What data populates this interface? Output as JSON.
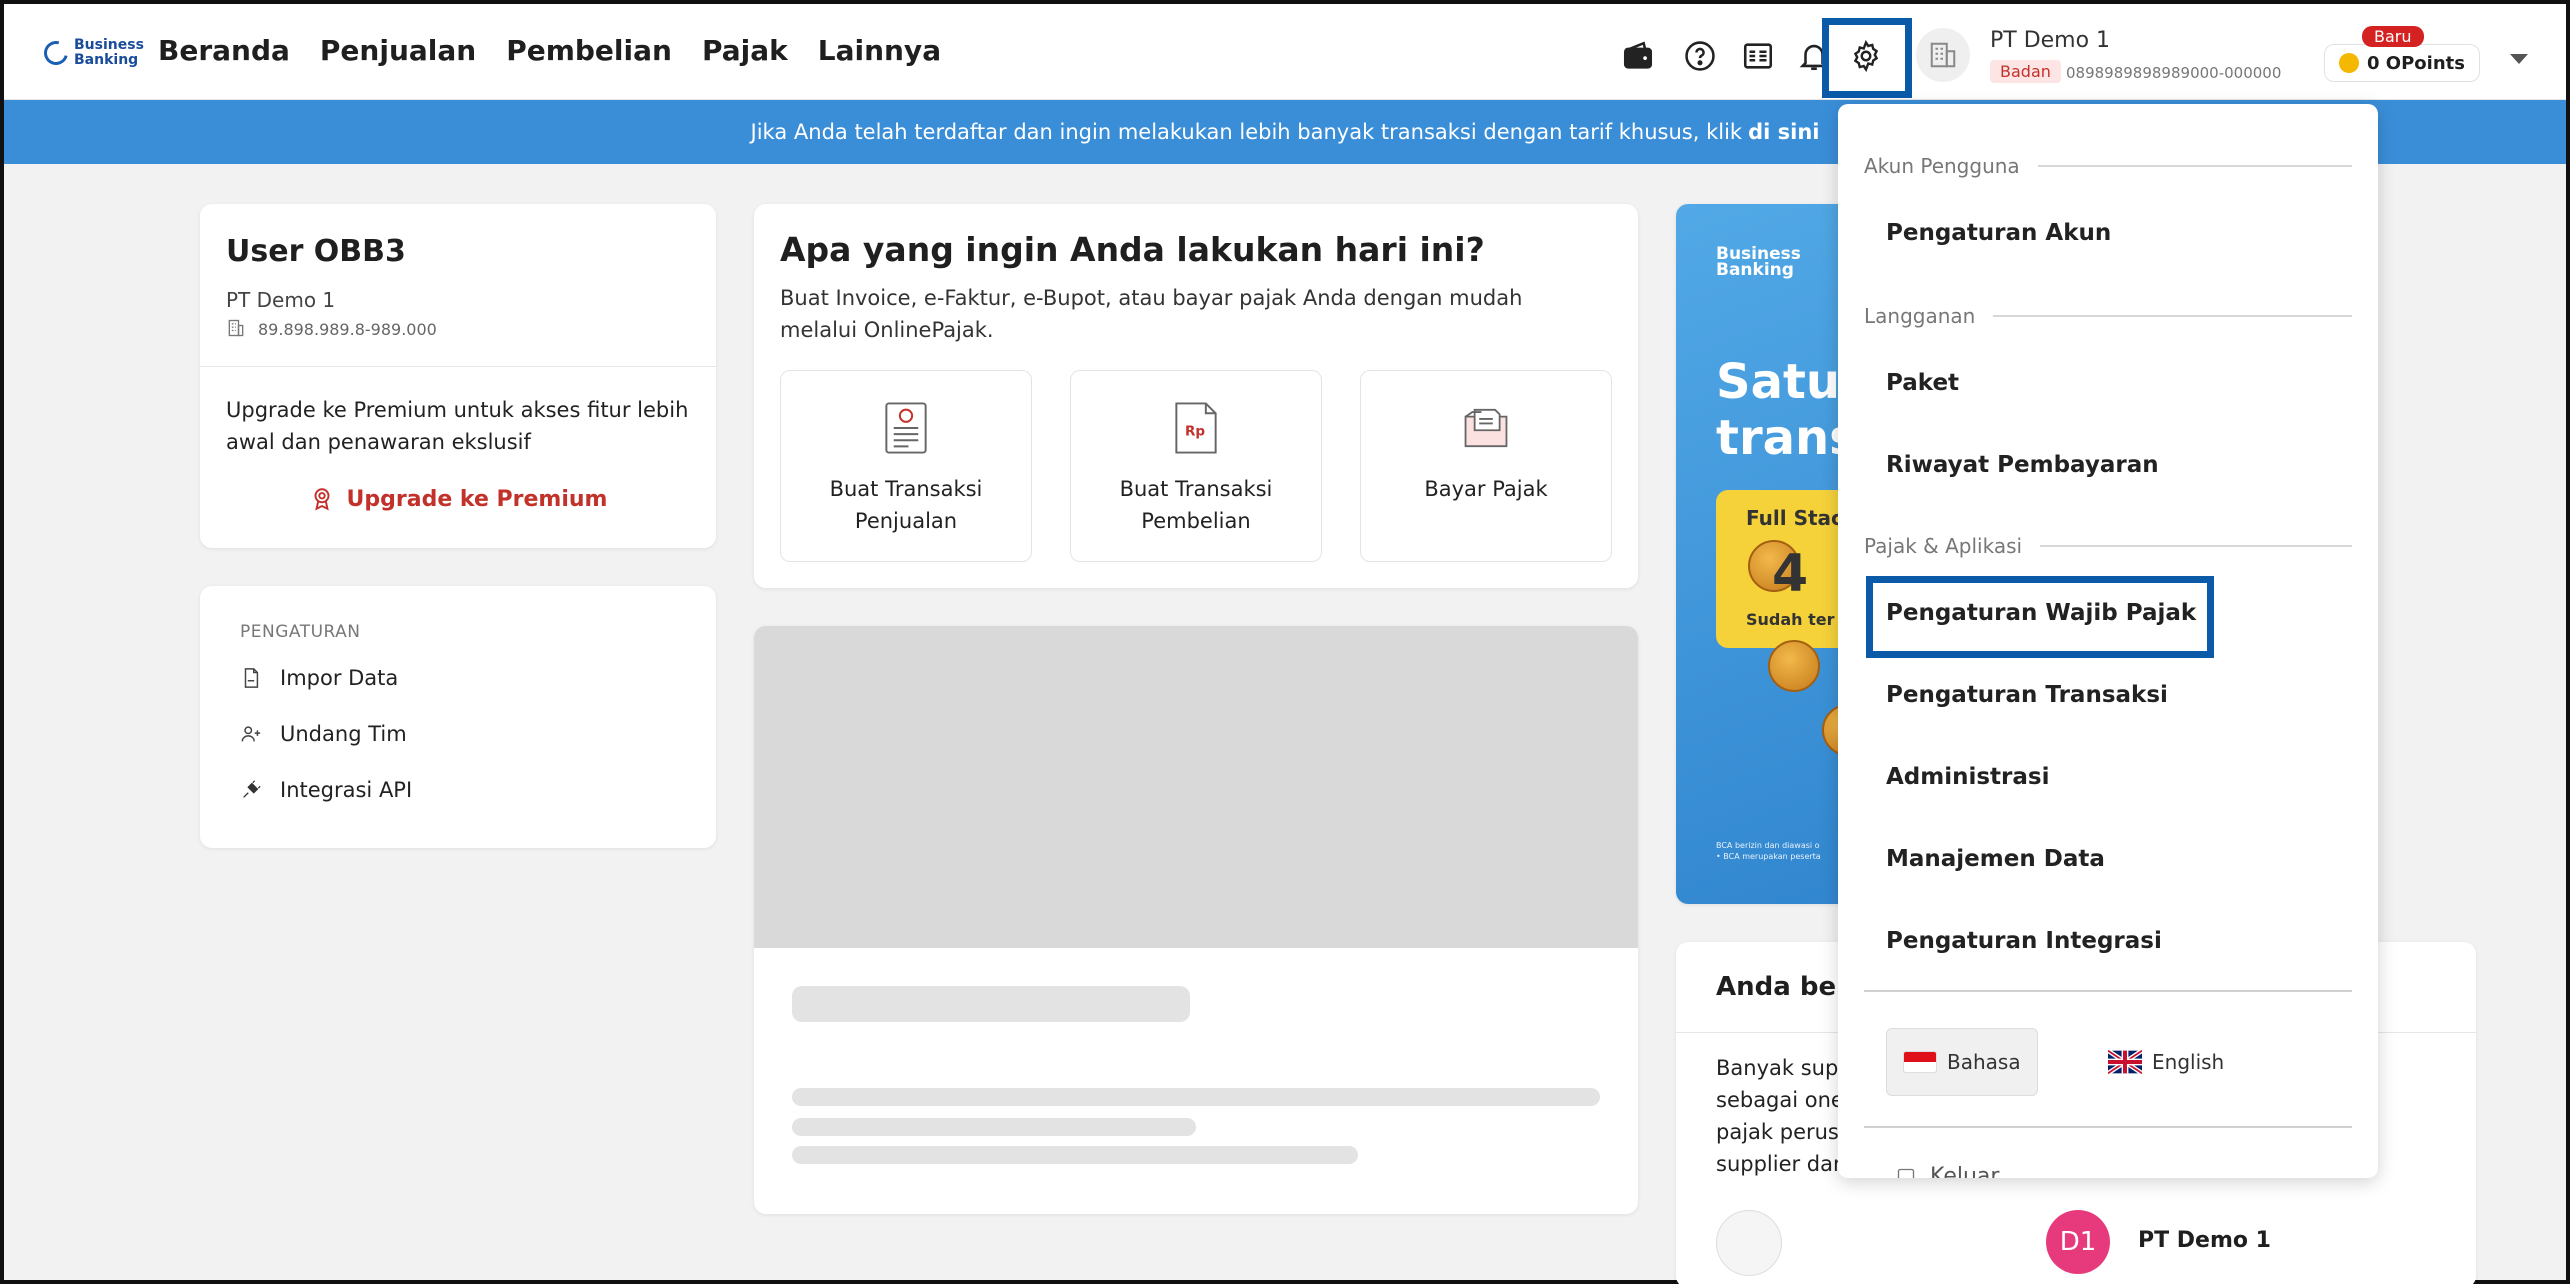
{
  "header": {
    "logo_text_1": "Business",
    "logo_text_2": "Banking",
    "nav": [
      "Beranda",
      "Penjualan",
      "Pembelian",
      "Pajak",
      "Lainnya"
    ],
    "company_name": "PT Demo 1",
    "entity_badge": "Badan",
    "phone": "0898989898989000-000000",
    "points_badge": "Baru",
    "points_label": "0 OPoints"
  },
  "banner": {
    "text": "Jika Anda telah terdaftar dan ingin melakukan lebih banyak transaksi dengan tarif khusus, klik",
    "link": "di sini"
  },
  "user_card": {
    "name": "User OBB3",
    "company": "PT Demo 1",
    "npwp": "89.898.989.8-989.000",
    "upgrade_desc": "Upgrade ke Premium untuk akses fitur lebih awal dan penawaran ekslusif",
    "upgrade_link": "Upgrade ke Premium"
  },
  "settings_card": {
    "heading": "PENGATURAN",
    "items": [
      "Impor Data",
      "Undang Tim",
      "Integrasi API"
    ]
  },
  "action_card": {
    "title": "Apa yang ingin Anda lakukan hari ini?",
    "subtitle": "Buat Invoice, e-Faktur, e-Bupot, atau bayar pajak Anda dengan mudah melalui OnlinePajak.",
    "tiles": [
      {
        "label_1": "Buat Transaksi",
        "label_2": "Penjualan"
      },
      {
        "label_1": "Buat Transaksi",
        "label_2": "Pembelian"
      },
      {
        "label_1": "Bayar Pajak",
        "label_2": ""
      }
    ]
  },
  "promo": {
    "logo_1": "Business",
    "logo_2": "Banking",
    "headline_1": "Satu",
    "headline_2": "trans",
    "box_title": "Full Stac",
    "box_big": "4",
    "box_sub": "Sudah ter",
    "fine_1": "BCA berizin dan diawasi o",
    "fine_2": "• BCA merupakan peserta"
  },
  "bottom_card": {
    "title": "Anda bera",
    "text_lines": [
      "Banyak sup",
      "sebagai one",
      "pajak perus",
      "supplier dan"
    ],
    "avatar_initials": "D1",
    "avatar_name": "PT Demo 1"
  },
  "dropdown": {
    "section_account": "Akun Pengguna",
    "account_settings": "Pengaturan Akun",
    "section_subscription": "Langganan",
    "package": "Paket",
    "payment_history": "Riwayat Pembayaran",
    "section_tax": "Pajak & Aplikasi",
    "taxpayer_settings": "Pengaturan Wajib Pajak",
    "transaction_settings": "Pengaturan Transaksi",
    "administration": "Administrasi",
    "data_management": "Manajemen Data",
    "integration_settings": "Pengaturan Integrasi",
    "lang_id": "Bahasa",
    "lang_en": "English",
    "logout": "Keluar"
  },
  "colors": {
    "brand_blue": "#3a8ed8",
    "highlight_blue": "#0b5aa8",
    "danger_red": "#c3312b",
    "avatar_pink": "#e73a7c"
  }
}
